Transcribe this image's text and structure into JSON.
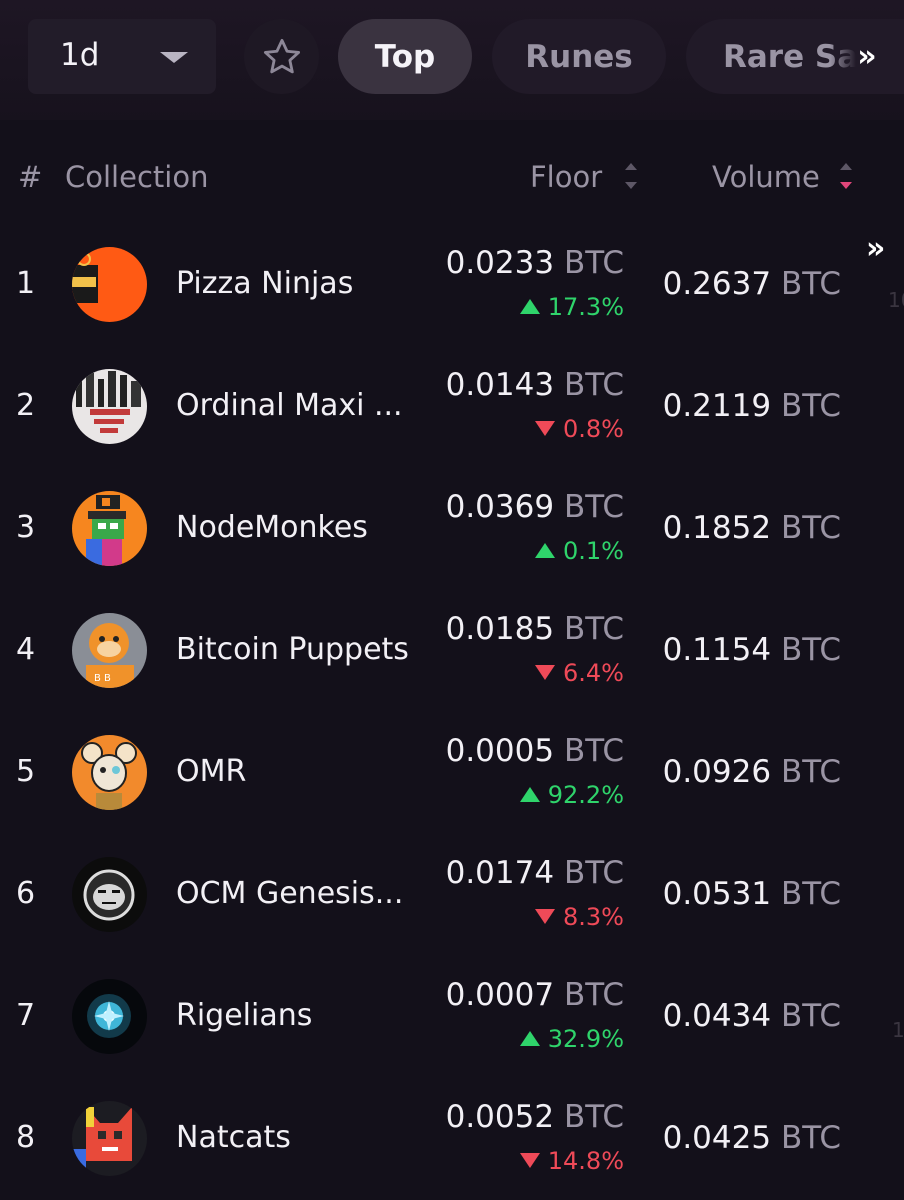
{
  "toolbar": {
    "period": "1d",
    "tabs": [
      "Top",
      "Runes",
      "Rare Sats"
    ],
    "active_tab": "Top",
    "more": "»"
  },
  "table": {
    "columns": {
      "rank": "#",
      "collection": "Collection",
      "floor": "Floor",
      "volume": "Volume"
    },
    "sort": {
      "column": "Volume",
      "direction": "desc"
    },
    "rows": [
      {
        "rank": "1",
        "name": "Pizza Ninjas",
        "floor": "0.0233",
        "floor_unit": "BTC",
        "change": "17.3%",
        "direction": "up",
        "volume": "0.2637",
        "volume_unit": "BTC"
      },
      {
        "rank": "2",
        "name": "Ordinal Maxi ...",
        "floor": "0.0143",
        "floor_unit": "BTC",
        "change": "0.8%",
        "direction": "down",
        "volume": "0.2119",
        "volume_unit": "BTC"
      },
      {
        "rank": "3",
        "name": "NodeMonkes",
        "floor": "0.0369",
        "floor_unit": "BTC",
        "change": "0.1%",
        "direction": "up",
        "volume": "0.1852",
        "volume_unit": "BTC"
      },
      {
        "rank": "4",
        "name": "Bitcoin Puppets",
        "floor": "0.0185",
        "floor_unit": "BTC",
        "change": "6.4%",
        "direction": "down",
        "volume": "0.1154",
        "volume_unit": "BTC"
      },
      {
        "rank": "5",
        "name": "OMR",
        "floor": "0.0005",
        "floor_unit": "BTC",
        "change": "92.2%",
        "direction": "up",
        "volume": "0.0926",
        "volume_unit": "BTC"
      },
      {
        "rank": "6",
        "name": "OCM Genesis...",
        "floor": "0.0174",
        "floor_unit": "BTC",
        "change": "8.3%",
        "direction": "down",
        "volume": "0.0531",
        "volume_unit": "BTC"
      },
      {
        "rank": "7",
        "name": "Rigelians",
        "floor": "0.0007",
        "floor_unit": "BTC",
        "change": "32.9%",
        "direction": "up",
        "volume": "0.0434",
        "volume_unit": "BTC"
      },
      {
        "rank": "8",
        "name": "Natcats",
        "floor": "0.0052",
        "floor_unit": "BTC",
        "change": "14.8%",
        "direction": "down",
        "volume": "0.0425",
        "volume_unit": "BTC"
      }
    ],
    "row_more": "»"
  },
  "colors": {
    "up": "#2fd46b",
    "down": "#ef4a58",
    "sort_active": "#e0467a",
    "background": "#13101a"
  }
}
